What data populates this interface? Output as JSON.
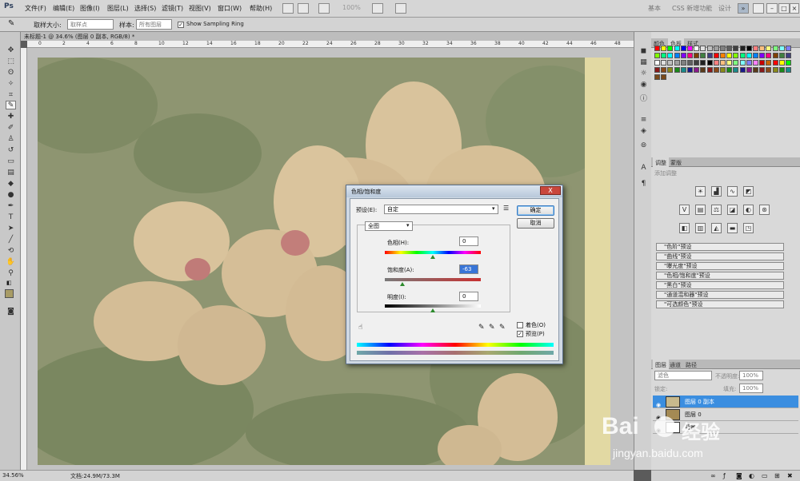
{
  "app": {
    "logo": "Ps"
  },
  "menu": [
    "文件(F)",
    "编辑(E)",
    "图像(I)",
    "图层(L)",
    "选择(S)",
    "滤镜(T)",
    "视图(V)",
    "窗口(W)",
    "帮助(H)"
  ],
  "menubar": {
    "zoom": "100%",
    "workspaces": [
      "基本",
      "CSS 新增功能",
      "设计"
    ],
    "more": "»"
  },
  "options": {
    "sample_size_label": "取样大小:",
    "sample_size_value": "取样点",
    "sample_label": "样本:",
    "sample_value": "所有图层",
    "show_ring_label": "Show Sampling Ring",
    "show_ring_checked": "✓"
  },
  "document": {
    "tab_title": "未标题-1 @ 34.6% (图层 0 副本, RGB/8) *",
    "ruler_ticks": [
      "0",
      "2",
      "4",
      "6",
      "8",
      "10",
      "12",
      "14",
      "16",
      "18",
      "20",
      "22",
      "24",
      "26",
      "28",
      "30",
      "32",
      "34",
      "36",
      "38",
      "40",
      "42",
      "44",
      "46",
      "48"
    ]
  },
  "status": {
    "zoom": "34.56%",
    "doc": "文档:24.9M/73.3M"
  },
  "panels": {
    "color_tabs": [
      "颜色",
      "色板",
      "样式"
    ],
    "adjust_tabs": [
      "调整",
      "蒙版"
    ],
    "adjust_hint": "添加调整",
    "presets": [
      "\"色阶\"预设",
      "\"曲线\"预设",
      "\"曝光度\"预设",
      "\"色相/饱和度\"预设",
      "\"黑白\"预设",
      "\"通道混和器\"预设",
      "\"可选颜色\"预设"
    ],
    "layer_tabs": [
      "图层",
      "通道",
      "路径"
    ],
    "blend_mode": "滤色",
    "opacity_label": "不透明度:",
    "opacity": "100%",
    "lock_label": "锁定:",
    "fill_label": "填充:",
    "fill": "100%",
    "layers": [
      {
        "name": "图层 0 副本",
        "selected": true
      },
      {
        "name": "图层 0",
        "selected": false
      },
      {
        "name": "背景",
        "selected": false
      }
    ]
  },
  "dialog": {
    "title": "色相/饱和度",
    "close": "X",
    "preset_label": "预设(E):",
    "preset_value": "自定",
    "ok": "确定",
    "cancel": "取消",
    "channel": "全图",
    "hue_label": "色相(H):",
    "hue_value": "0",
    "sat_label": "饱和度(A):",
    "sat_value": "-63",
    "light_label": "明度(I):",
    "light_value": "0",
    "colorize_label": "着色(O)",
    "colorize_checked": "",
    "preview_label": "预览(P)",
    "preview_checked": "✓"
  },
  "watermark": {
    "brand": "Bai",
    "brand2": "经验",
    "url": "jingyan.baidu.com"
  }
}
